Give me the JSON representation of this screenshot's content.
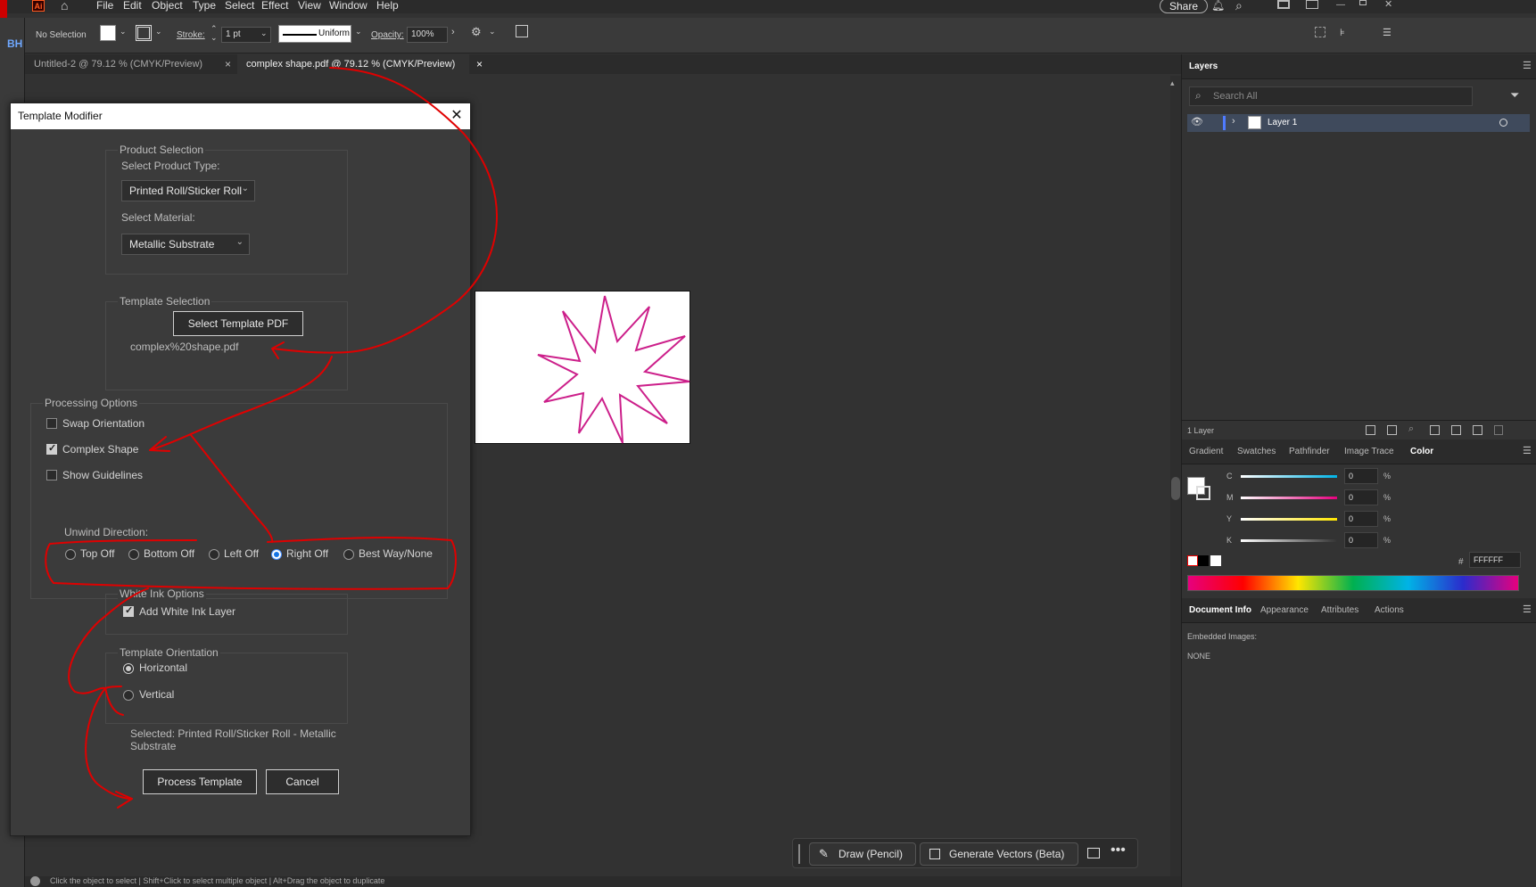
{
  "menubar": {
    "app_badge": "Ai",
    "items": [
      "File",
      "Edit",
      "Object",
      "Type",
      "Select",
      "Effect",
      "View",
      "Window",
      "Help"
    ],
    "share_label": "Share"
  },
  "left_strip": {
    "label": "BH"
  },
  "controlbar": {
    "selection": "No Selection",
    "stroke_label": "Stroke:",
    "stroke_value": "1 pt",
    "uniform_label": "Uniform",
    "opacity_label": "Opacity:",
    "opacity_value": "100%"
  },
  "tabs": [
    {
      "label": "Untitled-2 @ 79.12 % (CMYK/Preview)",
      "close": "×"
    },
    {
      "label": "complex shape.pdf @ 79.12 % (CMYK/Preview)",
      "close": "×"
    }
  ],
  "dialog": {
    "title": "Template Modifier",
    "close": "✕",
    "product": {
      "group_label": "Product Selection",
      "type_label": "Select Product Type:",
      "type_value": "Printed Roll/Sticker Roll",
      "material_label": "Select Material:",
      "material_value": "Metallic Substrate"
    },
    "template": {
      "group_label": "Template Selection",
      "button": "Select Template PDF",
      "filename": "complex%20shape.pdf"
    },
    "processing": {
      "group_label": "Processing Options",
      "swap": "Swap Orientation",
      "complex": "Complex Shape",
      "guidelines": "Show Guidelines",
      "unwind_label": "Unwind Direction:",
      "unwind_options": [
        "Top Off",
        "Bottom Off",
        "Left Off",
        "Right Off",
        "Best Way/None"
      ]
    },
    "white_ink": {
      "group_label": "White Ink Options",
      "add": "Add White Ink Layer"
    },
    "orientation": {
      "group_label": "Template Orientation",
      "horizontal": "Horizontal",
      "vertical": "Vertical"
    },
    "selected_text": "Selected: Printed Roll/Sticker Roll - Metallic Substrate",
    "process_button": "Process Template",
    "cancel_button": "Cancel"
  },
  "context_bar": {
    "draw": "Draw (Pencil)",
    "generate": "Generate Vectors (Beta)"
  },
  "status": "Click the object to select  |  Shift+Click to select multiple object  |  Alt+Drag the object to duplicate",
  "layers": {
    "title": "Layers",
    "search_placeholder": "Search All",
    "layer_name": "Layer 1",
    "count": "1 Layer"
  },
  "color_panel": {
    "tabs": [
      "Gradient",
      "Swatches",
      "Pathfinder",
      "Image Trace",
      "Color"
    ],
    "channels": [
      {
        "name": "C",
        "value": "0",
        "color": "#00b3e6"
      },
      {
        "name": "M",
        "value": "0",
        "color": "#e6007e"
      },
      {
        "name": "Y",
        "value": "0",
        "color": "#ffe600"
      },
      {
        "name": "K",
        "value": "0",
        "color": "#777777"
      }
    ],
    "percent": "%",
    "hash": "#",
    "hex": "FFFFFF"
  },
  "doc_info": {
    "tabs": [
      "Document Info",
      "Appearance",
      "Attributes",
      "Actions"
    ],
    "label": "Embedded Images:",
    "value": "NONE"
  },
  "colors": {
    "annotation": "#e00000",
    "star_stroke": "#cc1f8a",
    "accent": "#1473e6"
  }
}
